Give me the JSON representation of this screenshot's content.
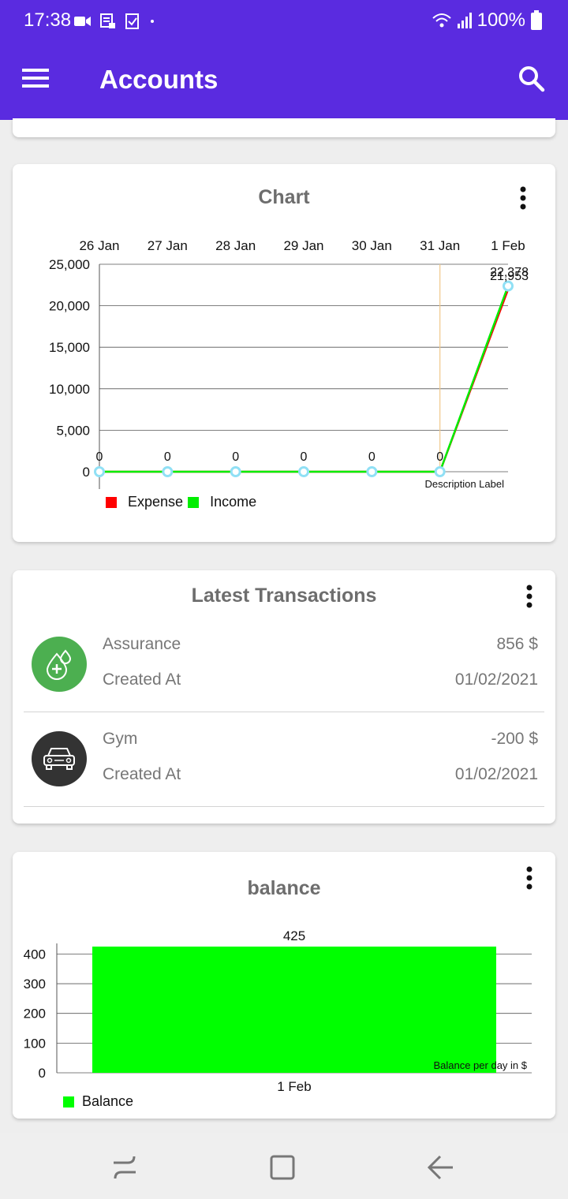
{
  "status_bar": {
    "time": "17:38",
    "battery": "100%"
  },
  "app_bar": {
    "title": "Accounts",
    "menu_icon": "hamburger-menu-icon",
    "search_icon": "search-icon"
  },
  "chart_card": {
    "title": "Chart",
    "description_label": "Description Label",
    "legend": [
      {
        "label": "Expense",
        "color": "#ff0000"
      },
      {
        "label": "Income",
        "color": "#00ee00"
      }
    ]
  },
  "chart_data": [
    {
      "type": "line",
      "title": "Chart",
      "categories": [
        "26 Jan",
        "27 Jan",
        "28 Jan",
        "29 Jan",
        "30 Jan",
        "31 Jan",
        "1 Feb"
      ],
      "series": [
        {
          "name": "Expense",
          "color": "#ff0000",
          "values": [
            0,
            0,
            0,
            0,
            0,
            0,
            21953
          ]
        },
        {
          "name": "Income",
          "color": "#00ee00",
          "values": [
            0,
            0,
            0,
            0,
            0,
            0,
            22378
          ]
        }
      ],
      "point_labels": [
        "0",
        "0",
        "0",
        "0",
        "0",
        "0"
      ],
      "end_labels": [
        "22,378",
        "21,953"
      ],
      "y_ticks": [
        "0",
        "5,000",
        "10,000",
        "15,000",
        "20,000",
        "25,000"
      ],
      "ylim": [
        0,
        25000
      ],
      "x_axis_position": "top",
      "grid": true,
      "legend_position": "bottom-left"
    },
    {
      "type": "bar",
      "title": "balance",
      "categories": [
        "1 Feb"
      ],
      "series": [
        {
          "name": "Balance",
          "color": "#00ff00",
          "values": [
            425
          ]
        }
      ],
      "value_labels": [
        "425"
      ],
      "y_ticks": [
        "0",
        "100",
        "200",
        "300",
        "400"
      ],
      "ylim": [
        0,
        425
      ],
      "grid": true,
      "legend_position": "bottom-left"
    }
  ],
  "transactions_card": {
    "title": "Latest Transactions",
    "items": [
      {
        "name": "Assurance",
        "created_label": "Created At",
        "amount": "856 $",
        "date": "01/02/2021",
        "icon": "health-drop-icon",
        "icon_bg": "#4caf50"
      },
      {
        "name": "Gym",
        "created_label": "Created At",
        "amount": "-200 $",
        "date": "01/02/2021",
        "icon": "car-icon",
        "icon_bg": "#333333"
      }
    ]
  },
  "balance_card": {
    "title": "balance",
    "description_label": "Balance per day in $",
    "legend": [
      {
        "label": "Balance",
        "color": "#00ff00"
      }
    ]
  },
  "nav_bar": {
    "recents_icon": "recents-icon",
    "home_icon": "home-icon",
    "back_icon": "back-icon"
  }
}
